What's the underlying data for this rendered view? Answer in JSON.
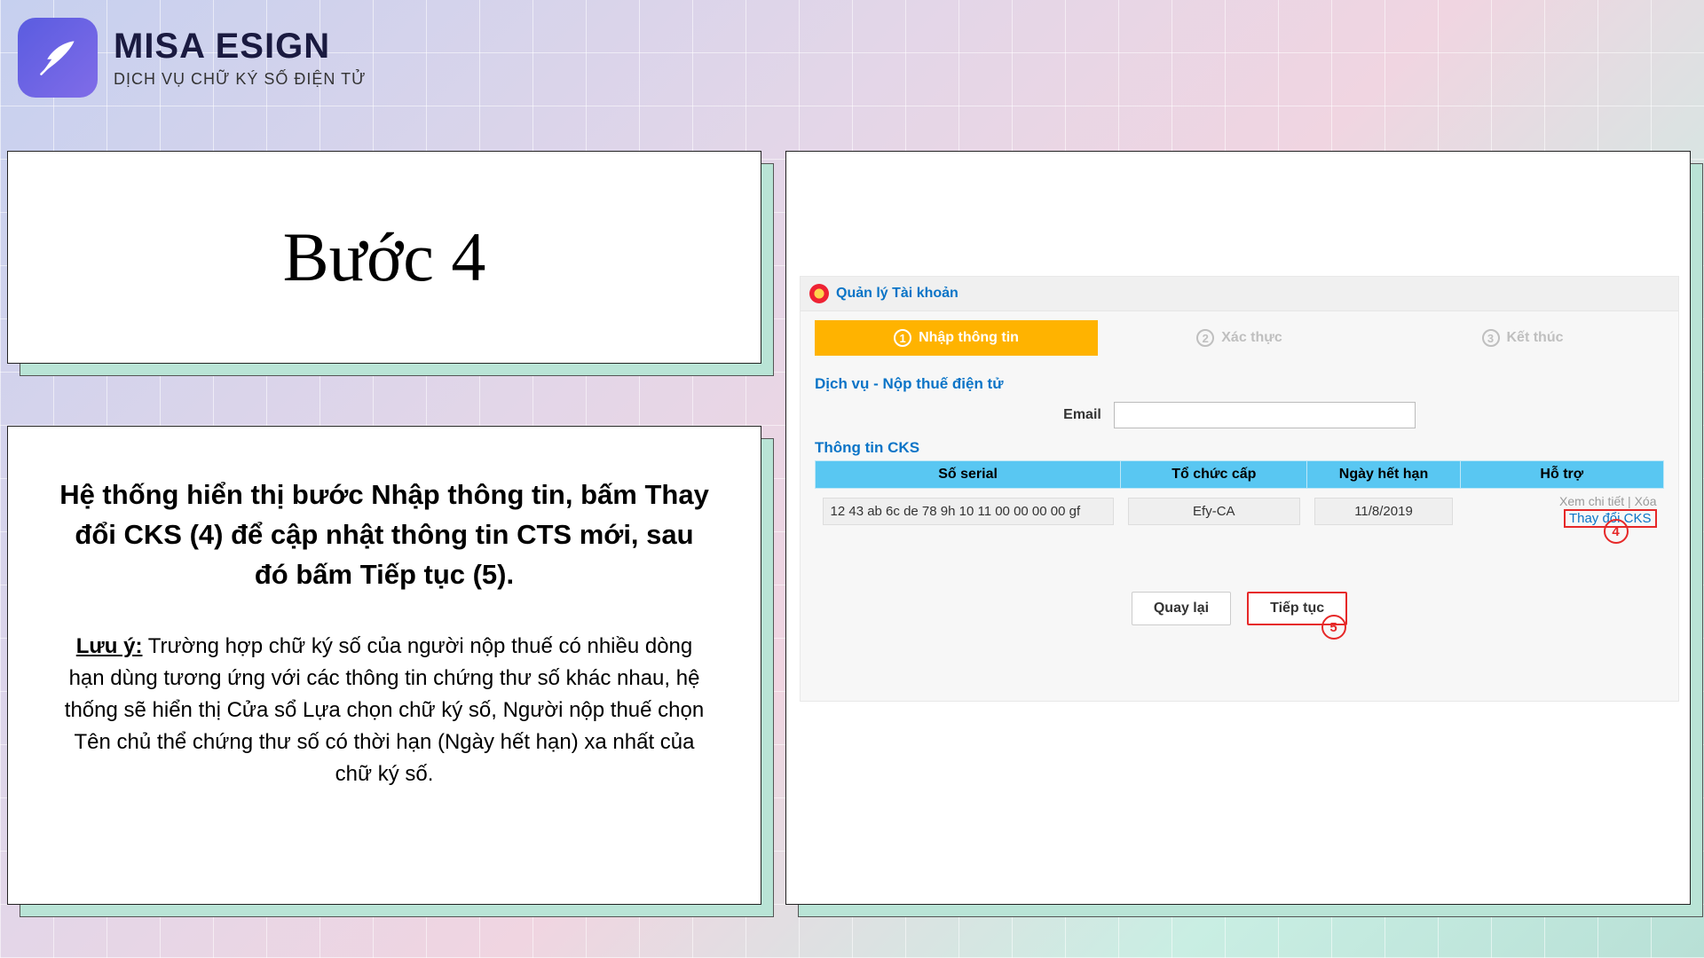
{
  "brand": {
    "title": "MISA ESIGN",
    "subtitle": "DỊCH VỤ CHỮ KÝ SỐ ĐIỆN TỬ"
  },
  "step_title": "Bước 4",
  "instruction_main": "Hệ thống hiển thị bước Nhập thông tin, bấm Thay đổi CKS (4) để cập nhật thông tin CTS mới, sau đó bấm Tiếp tục (5).",
  "note_label": "Lưu ý:",
  "note_body": " Trường hợp chữ ký số của người nộp thuế có nhiều dòng hạn dùng tương ứng với các thông tin chứng thư số khác nhau, hệ thống sẽ hiển thị Cửa sổ Lựa chọn chữ ký số, Người nộp thuế chọn Tên chủ thể chứng thư số có thời hạn (Ngày hết hạn) xa nhất của chữ ký số.",
  "portal": {
    "page_title": "Quản lý Tài khoản",
    "steps": [
      "Nhập thông tin",
      "Xác thực",
      "Kết thúc"
    ],
    "service": "Dịch vụ - Nộp thuế điện tử",
    "email_label": "Email",
    "email_value": "",
    "cks_section": "Thông tin CKS",
    "columns": [
      "Số serial",
      "Tổ chức cấp",
      "Ngày hết hạn",
      "Hỗ trợ"
    ],
    "row": {
      "serial": "12 43 ab 6c de 78 9h 10 11 00 00 00 00 gf",
      "issuer": "Efy-CA",
      "expiry": "11/8/2019"
    },
    "support_links": {
      "view": "Xem chi tiết",
      "sep": " | ",
      "del": "Xóa",
      "change": "Thay đổi CKS"
    },
    "markers": {
      "m4": "4",
      "m5": "5"
    },
    "buttons": {
      "back": "Quay lại",
      "next": "Tiếp tục"
    }
  }
}
